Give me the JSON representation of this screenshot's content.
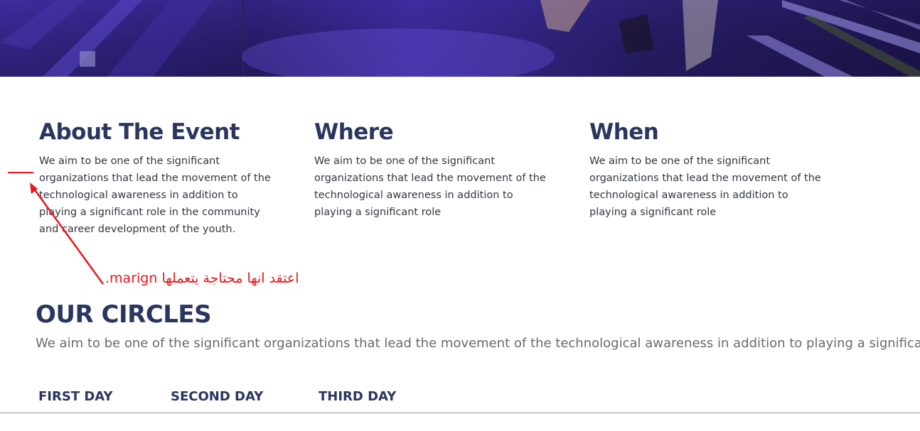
{
  "columns": [
    {
      "title": "About The Event",
      "text": "We aim to be one of the significant organizations that lead the movement of the technological awareness in addition to playing a significant role in the community and career development of the youth."
    },
    {
      "title": "Where",
      "text": "We aim to be one of the significant organizations that lead the movement of the technological awareness in addition to playing a significant role"
    },
    {
      "title": "When",
      "text": "We aim to be one of the significant organizations that lead the movement of the technological awareness in addition to playing a significant role"
    }
  ],
  "annotation": {
    "text": "اعتقد انها محتاجة يتعملها marign.",
    "color": "#e8161b"
  },
  "circles": {
    "title": "OUR CIRCLES",
    "subtitle": "We aim to be one of the significant organizations that lead the movement of the technological awareness in addition to playing a significant role"
  },
  "days": [
    "FIRST DAY",
    "SECOND DAY",
    "THIRD DAY"
  ],
  "colors": {
    "heading": "#2b3660",
    "body_text": "#33363f",
    "muted_text": "#666a72",
    "hero_tint": "#3a2a9a"
  }
}
